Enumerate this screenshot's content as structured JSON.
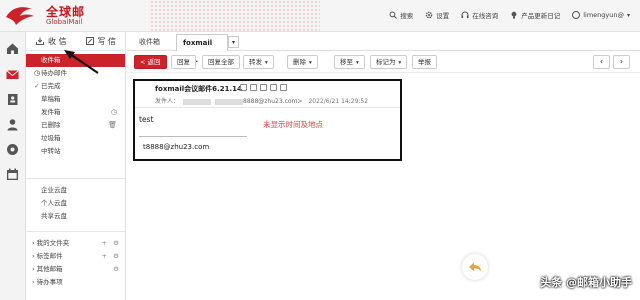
{
  "header": {
    "logo_title": "全球邮",
    "logo_sub": "GlobalMail",
    "nav": {
      "search": "搜索",
      "settings": "设置",
      "support": "在线咨询",
      "updates": "产品更新日记",
      "user": "limengyun@"
    }
  },
  "sidebar": {
    "receive_label": "收 信",
    "compose_label": "写 信",
    "folders": [
      {
        "label": "收件箱",
        "active": true
      },
      {
        "label": "待办邮件",
        "prefix": "◷"
      },
      {
        "label": "已完成",
        "prefix": "✓"
      },
      {
        "label": "草稿箱"
      },
      {
        "label": "发件箱",
        "suffix": "◷"
      },
      {
        "label": "已删除",
        "suffix": "🗑"
      },
      {
        "label": "垃圾箱"
      },
      {
        "label": "中转站"
      }
    ],
    "cloud": [
      "企业云盘",
      "个人云盘",
      "共享云盘"
    ],
    "groups": [
      "我的文件夹",
      "标签邮件",
      "其他邮箱",
      "待办事项"
    ]
  },
  "tabs": {
    "inbox": "收件箱",
    "current": "foxmail会..."
  },
  "toolbar": {
    "back": "< 返回",
    "reply": "回复",
    "reply_all": "回复全部",
    "forward": "转发",
    "delete": "删除",
    "move": "移至",
    "mark": "标记为",
    "report": "举报"
  },
  "message": {
    "subject": "foxmail会议邮件6.21.14",
    "sender_label": "发件人：",
    "sender_address": "8888@zhu23.com>",
    "date": "2022/6/21 14:29:52",
    "body_text": "test",
    "annotation": "未显示时间及地点",
    "signature": "t8888@zhu23.com"
  },
  "watermark": "头条 @邮箱小助手",
  "colors": {
    "brand_red": "#cc2229",
    "annotation_red": "#e43b3b"
  }
}
